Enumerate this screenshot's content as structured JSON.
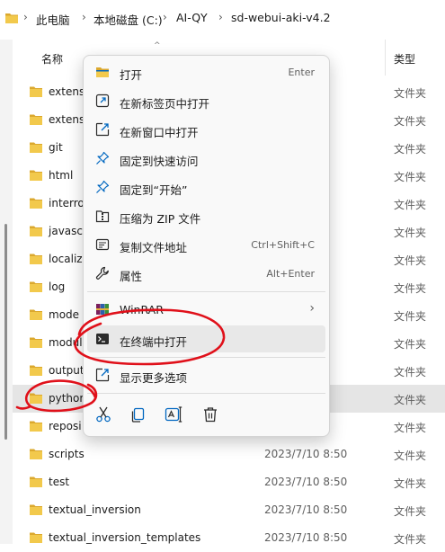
{
  "address_bar": {
    "crumbs": [
      "此电脑",
      "本地磁盘 (C:)",
      "AI-QY",
      "sd-webui-aki-v4.2"
    ],
    "separator": "›"
  },
  "columns": {
    "name": "名称",
    "type": "类型"
  },
  "files": [
    {
      "name": "extens",
      "date": ":45",
      "type": "文件夹"
    },
    {
      "name": "extens",
      "date": ":45",
      "type": "文件夹"
    },
    {
      "name": "git",
      "date": ":45",
      "type": "文件夹"
    },
    {
      "name": "html",
      "date": ":45",
      "type": "文件夹"
    },
    {
      "name": "interro",
      "date": ":45",
      "type": "文件夹"
    },
    {
      "name": "javasc",
      "date": ":45",
      "type": "文件夹"
    },
    {
      "name": "localiz",
      "date": ":45",
      "type": "文件夹"
    },
    {
      "name": "log",
      "date": ":45",
      "type": "文件夹"
    },
    {
      "name": "mode",
      "date": ":48",
      "type": "文件夹"
    },
    {
      "name": "modul",
      "date": ":45",
      "type": "文件夹"
    },
    {
      "name": "output",
      "date": ":45",
      "type": "文件夹"
    },
    {
      "name": "pythor",
      "date": ":49",
      "type": "文件夹"
    },
    {
      "name": "reposi",
      "date": ":50",
      "type": "文件夹"
    },
    {
      "name": "scripts",
      "date": "2023/7/10 8:50",
      "type": "文件夹"
    },
    {
      "name": "test",
      "date": "2023/7/10 8:50",
      "type": "文件夹"
    },
    {
      "name": "textual_inversion",
      "date": "2023/7/10 8:50",
      "type": "文件夹"
    },
    {
      "name": "textual_inversion_templates",
      "date": "2023/7/10 8:50",
      "type": "文件夹"
    }
  ],
  "context_menu": {
    "items": [
      {
        "label": "打开",
        "shortcut": "Enter"
      },
      {
        "label": "在新标签页中打开",
        "shortcut": ""
      },
      {
        "label": "在新窗口中打开",
        "shortcut": ""
      },
      {
        "label": "固定到快速访问",
        "shortcut": ""
      },
      {
        "label": "固定到“开始”",
        "shortcut": ""
      },
      {
        "label": "压缩为 ZIP 文件",
        "shortcut": ""
      },
      {
        "label": "复制文件地址",
        "shortcut": "Ctrl+Shift+C"
      },
      {
        "label": "属性",
        "shortcut": "Alt+Enter"
      }
    ],
    "winrar": {
      "label": "WinRAR",
      "arrow": "›"
    },
    "terminal": {
      "label": "在终端中打开"
    },
    "more": {
      "label": "显示更多选项"
    },
    "actions": [
      "cut",
      "copy",
      "rename",
      "delete"
    ]
  },
  "colors": {
    "folder": "#f2c94c",
    "folder_dark": "#dba82e",
    "accent": "#0067c0",
    "annotation": "#e0101a"
  }
}
